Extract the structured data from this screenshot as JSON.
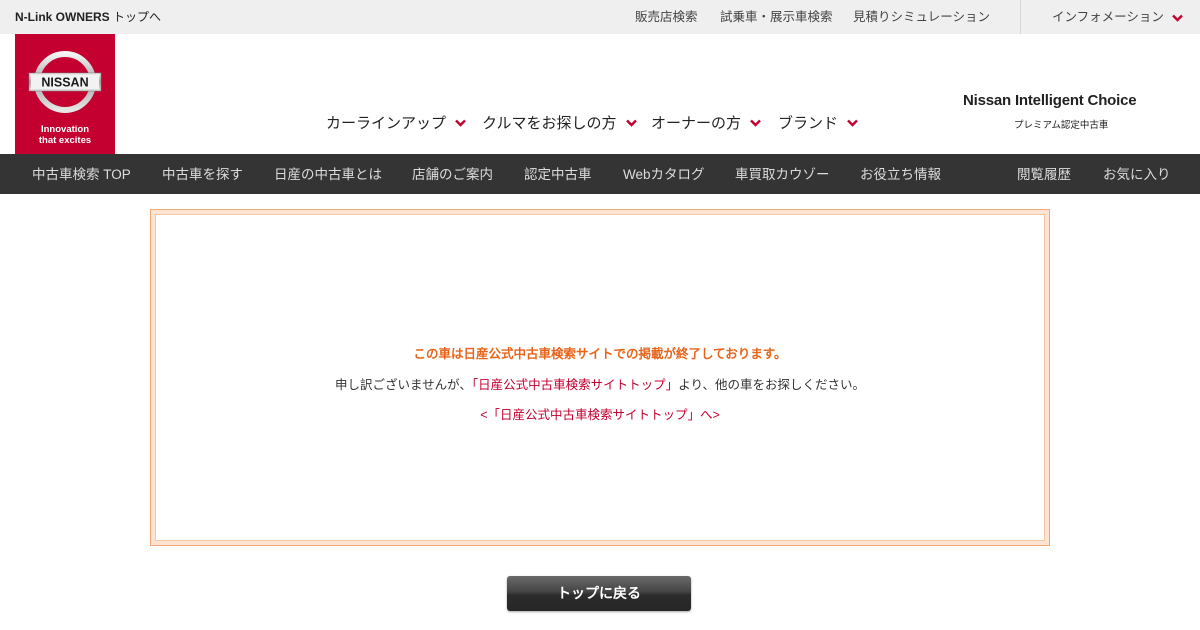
{
  "utility_bar": {
    "owners_link_bold": "N-Link OWNERS",
    "owners_link_rest": " トップへ",
    "links": [
      {
        "label": "販売店検索"
      },
      {
        "label": "試乗車・展示車検索"
      },
      {
        "label": "見積りシミュレーション"
      }
    ],
    "information": "インフォメーション"
  },
  "logo": {
    "brand": "NISSAN",
    "tagline_line1": "Innovation",
    "tagline_line2": "that excites"
  },
  "main_nav": {
    "items": [
      {
        "label": "カーラインアップ"
      },
      {
        "label": "クルマをお探しの方"
      },
      {
        "label": "オーナーの方"
      },
      {
        "label": "ブランド"
      }
    ]
  },
  "brand_right": {
    "title": "Nissan Intelligent Choice",
    "subtitle": "プレミアム認定中古車"
  },
  "dark_nav": {
    "items": [
      {
        "label": "中古車検索 TOP"
      },
      {
        "label": "中古車を探す"
      },
      {
        "label": "日産の中古車とは"
      },
      {
        "label": "店舗のご案内"
      },
      {
        "label": "認定中古車"
      },
      {
        "label": "Webカタログ"
      },
      {
        "label": "車買取カウゾー"
      },
      {
        "label": "お役立ち情報"
      },
      {
        "label": "閲覧履歴"
      },
      {
        "label": "お気に入り"
      }
    ]
  },
  "message": {
    "title": "この車は日産公式中古車検索サイトでの掲載が終了しております。",
    "body_before": "申し訳ございませんが、",
    "body_link": "「日産公式中古車検索サイトトップ」",
    "body_after": "より、他の車をお探しください。",
    "back_link": "<「日産公式中古車検索サイトトップ」へ>"
  },
  "back_button": {
    "label": "トップに戻る"
  },
  "colors": {
    "brand_red": "#c3002f",
    "notice_orange": "#e8641b",
    "dark_nav_bg": "#343434",
    "util_bar_bg": "#efefef"
  },
  "icons": {
    "chevron": "chevron-down-icon",
    "logo": "nissan-logo-icon"
  }
}
